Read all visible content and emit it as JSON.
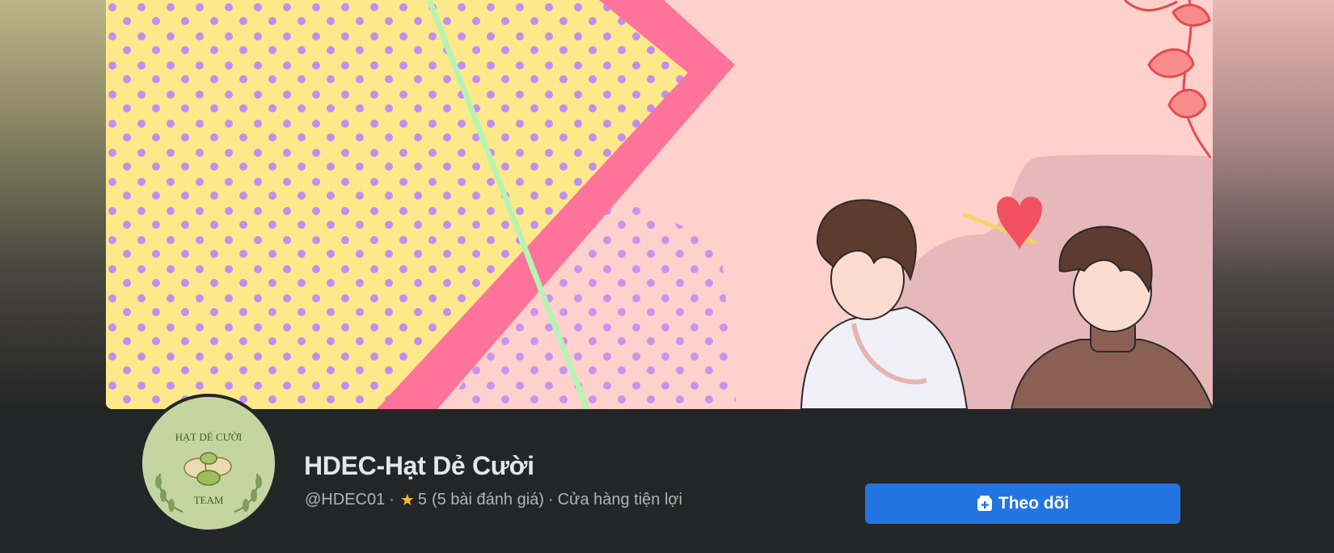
{
  "page": {
    "name": "HDEC-Hạt Dẻ Cười",
    "handle": "@HDEC01",
    "separator": "·",
    "rating": "5",
    "review_count": "(5 bài đánh giá)",
    "category": "Cửa hàng tiện lợi"
  },
  "avatar": {
    "top_text": "HẠT DẺ CƯỜI",
    "bottom_text": "TEAM"
  },
  "actions": {
    "follow_label": "Theo dõi"
  },
  "icons": {
    "rating": "star-icon",
    "follow": "follow-plus-icon"
  },
  "colors": {
    "page_bg": "#242526",
    "button_blue": "#2374e1",
    "text_primary": "#e4e6eb",
    "text_secondary": "#b0b3b8",
    "star": "#f7b928",
    "avatar_bg": "#c5d5a1"
  }
}
